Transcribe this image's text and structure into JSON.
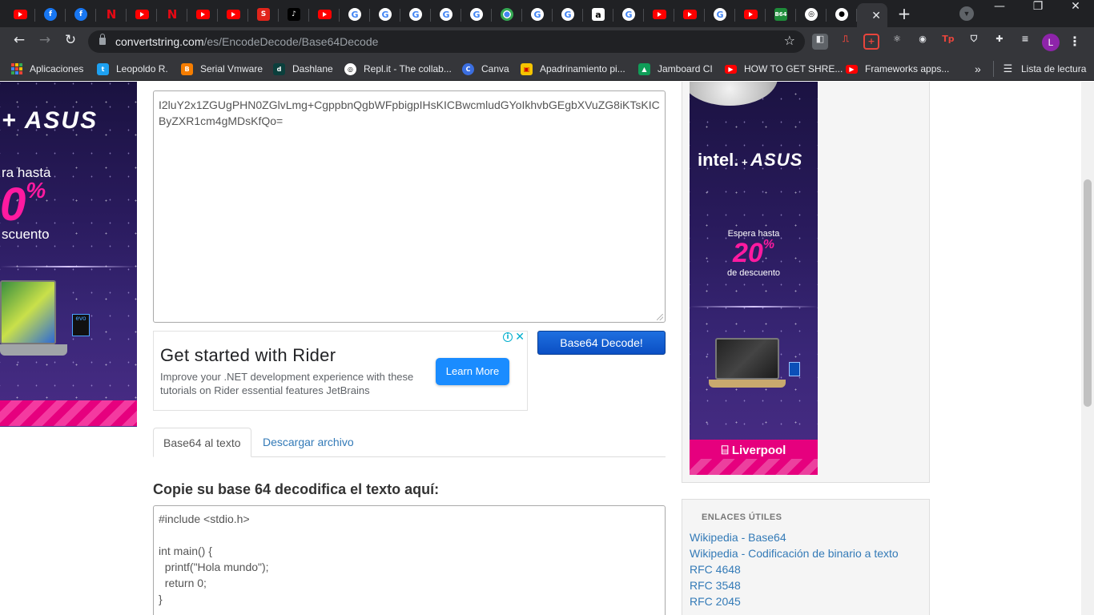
{
  "browser": {
    "tabs": [
      "yt",
      "fb",
      "fb",
      "nf",
      "yt",
      "nf",
      "yt",
      "yt",
      "s",
      "tk",
      "yt",
      "gg",
      "gg",
      "gg",
      "gg",
      "gg",
      "cr",
      "gg",
      "gg",
      "am",
      "gg",
      "yt",
      "yt",
      "gg",
      "yt",
      "gr",
      "sn",
      "gh"
    ],
    "active_tab_close": "✕",
    "new_tab": "+",
    "window": {
      "minimize": "—",
      "restore": "❐",
      "close": "✕"
    },
    "url_host": "convertstring.com",
    "url_path": "/es/EncodeDecode/Base64Decode",
    "profile_initial": "L",
    "bookmarks": [
      {
        "label": "Aplicaciones"
      },
      {
        "label": "Leopoldo R."
      },
      {
        "label": "Serial Vmware"
      },
      {
        "label": "Dashlane"
      },
      {
        "label": "Repl.it - The collab..."
      },
      {
        "label": "Canva"
      },
      {
        "label": "Apadrinamiento pi..."
      },
      {
        "label": "Jamboard CI"
      },
      {
        "label": "HOW TO GET SHRE..."
      },
      {
        "label": "Frameworks apps..."
      }
    ],
    "bookmarks_more": "»",
    "reading_list": "Lista de lectura"
  },
  "ads": {
    "left": {
      "brand": "ASUS",
      "offer_prefix": "ra hasta",
      "percent": "0",
      "percent_sign": "%",
      "offer_suffix": "scuento"
    },
    "right": {
      "brand_intel": "intel.",
      "brand_asus": "ASUS",
      "offer_prefix": "Espera hasta",
      "percent": "20",
      "percent_sign": "%",
      "offer_suffix": "de descuento",
      "store": "Liverpool"
    },
    "rider": {
      "title": "Get started with Rider",
      "description": "Improve your .NET development experience with these tutorials on Rider essential features JetBrains",
      "cta": "Learn More"
    }
  },
  "converter": {
    "input_value": "I2luY2x1ZGUgPHN0ZGlvLmg+CgppbnQgbWFpbigpIHsKICBwcmludGYoIkhvbGEgbXVuZG8iKTsKICByZXR1cm4gMDsKfQo=",
    "decode_button": "Base64 Decode!",
    "tab_text": "Base64 al texto",
    "tab_download": "Descargar archivo",
    "output_heading": "Copie su base 64 decodifica el texto aquí:",
    "output_value": "#include <stdio.h>\n\nint main() {\n  printf(\"Hola mundo\");\n  return 0;\n}"
  },
  "useful_links": {
    "heading": "ENLACES ÚTILES",
    "items": [
      "Wikipedia - Base64",
      "Wikipedia - Codificación de binario a texto",
      "RFC 4648",
      "RFC 3548",
      "RFC 2045"
    ]
  }
}
